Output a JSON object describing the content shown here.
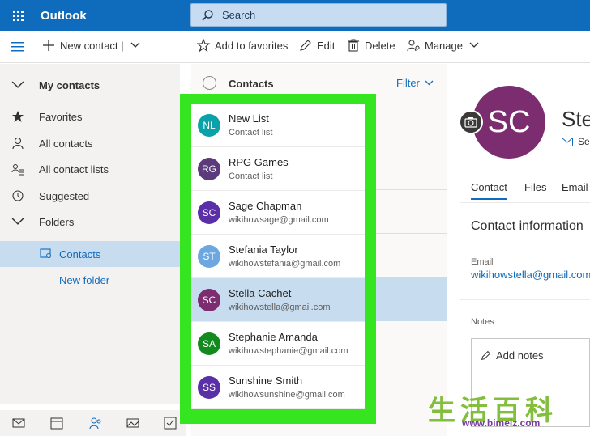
{
  "app": {
    "brand": "Outlook"
  },
  "search": {
    "placeholder": "Search"
  },
  "commands": {
    "new_contact": "New contact",
    "add_favorites": "Add to favorites",
    "edit": "Edit",
    "delete": "Delete",
    "manage": "Manage"
  },
  "sidebar": {
    "header": "My contacts",
    "items": [
      {
        "label": "Favorites",
        "icon": "star-icon"
      },
      {
        "label": "All contacts",
        "icon": "person-icon"
      },
      {
        "label": "All contact lists",
        "icon": "contact-list-icon"
      },
      {
        "label": "Suggested",
        "icon": "history-icon"
      },
      {
        "label": "Folders",
        "icon": "chevron-down-icon"
      }
    ],
    "selected": "Contacts",
    "new_folder": "New folder"
  },
  "list": {
    "title": "Contacts",
    "filter": "Filter",
    "contacts": [
      {
        "initials": "NL",
        "name": "New List",
        "sub": "Contact list",
        "color": "#0aa2a8"
      },
      {
        "initials": "RG",
        "name": "RPG Games",
        "sub": "Contact list",
        "color": "#5c3b7d"
      },
      {
        "initials": "SC",
        "name": "Sage Chapman",
        "sub": "wikihowsage@gmail.com",
        "color": "#5b2fa8"
      },
      {
        "initials": "ST",
        "name": "Stefania Taylor",
        "sub": "wikihowstefania@gmail.com",
        "color": "#6da7e0"
      },
      {
        "initials": "SC",
        "name": "Stella Cachet",
        "sub": "wikihowstella@gmail.com",
        "color": "#7b2d70"
      },
      {
        "initials": "SA",
        "name": "Stephanie Amanda",
        "sub": "wikihowstephanie@gmail.com",
        "color": "#138a1e"
      },
      {
        "initials": "SS",
        "name": "Sunshine Smith",
        "sub": "wikihowsunshine@gmail.com",
        "color": "#5b2fa8"
      }
    ],
    "selected_index": 4
  },
  "detail": {
    "initials": "SC",
    "name": "Stell",
    "mail_label": "Se",
    "tabs": [
      "Contact",
      "Files",
      "Email"
    ],
    "section_title": "Contact information",
    "email_label": "Email",
    "email_value": "wikihowstella@gmail.com",
    "notes_label": "Notes",
    "add_notes": "Add notes"
  },
  "watermark": {
    "glyphs": "生活百科",
    "url": "www.bimeiz.com"
  },
  "colors": {
    "brand_blue": "#0f6cbd",
    "highlight_green": "#35e51f",
    "selected_row": "#c7dcee"
  }
}
